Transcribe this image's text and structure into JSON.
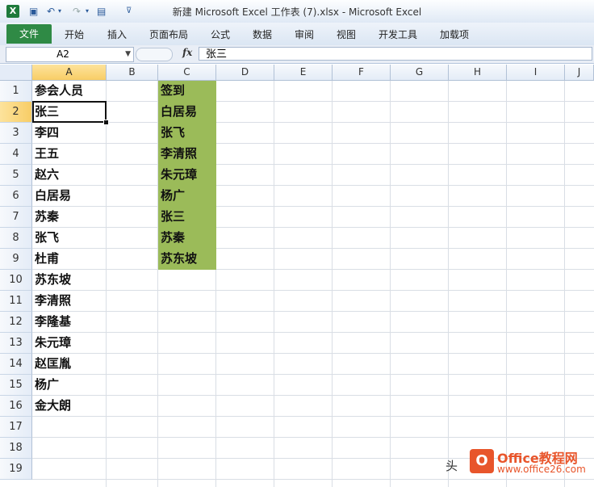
{
  "window": {
    "title": "新建 Microsoft Excel 工作表 (7).xlsx  -  Microsoft Excel",
    "app_icon": "excel-logo"
  },
  "ribbon": {
    "file_label": "文件",
    "tabs": [
      "开始",
      "插入",
      "页面布局",
      "公式",
      "数据",
      "审阅",
      "视图",
      "开发工具",
      "加载项"
    ]
  },
  "formula_bar": {
    "name_box": "A2",
    "fx_label": "fx",
    "content": "张三"
  },
  "grid": {
    "columns": [
      "A",
      "B",
      "C",
      "D",
      "E",
      "F",
      "G",
      "H",
      "I",
      "J"
    ],
    "selected_column": "A",
    "rows": [
      "1",
      "2",
      "3",
      "4",
      "5",
      "6",
      "7",
      "8",
      "9",
      "10",
      "11",
      "12",
      "13",
      "14",
      "15",
      "16",
      "17",
      "18",
      "19"
    ],
    "selected_row": "2",
    "column_a": [
      "参会人员",
      "张三",
      "李四",
      "王五",
      "赵六",
      "白居易",
      "苏秦",
      "张飞",
      "杜甫",
      "苏东坡",
      "李清照",
      "李隆基",
      "朱元璋",
      "赵匡胤",
      "杨广",
      "金大朗"
    ],
    "column_c": [
      "签到",
      "白居易",
      "张飞",
      "李清照",
      "朱元璋",
      "杨广",
      "张三",
      "苏秦",
      "苏东坡"
    ],
    "highlight_color": "#9bbb59"
  },
  "watermark": {
    "prefix": "头",
    "brand": "Office教程网",
    "url": "www.office26.com"
  }
}
